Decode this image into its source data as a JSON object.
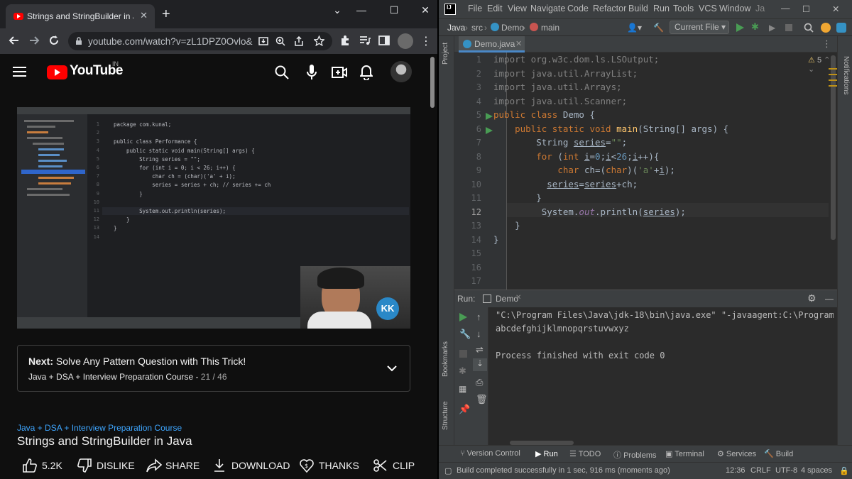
{
  "browser": {
    "tab_title": "Strings and StringBuilder in Ja",
    "url": "youtube.com/watch?v=zL1DPZ0Ovlo&l...",
    "new_tab": "+",
    "win_minimize": "—",
    "win_maximize": "☐",
    "win_close": "✕",
    "tab_close": "✕"
  },
  "youtube": {
    "logo_text": "YouTube",
    "region": "IN",
    "next_label": "Next:",
    "next_title": "Solve Any Pattern Question with This Trick!",
    "playlist": "Java + DSA + Interview Preparation Course -",
    "playlist_count": "21 / 46",
    "course_link": "Java + DSA + Interview Preparation Course",
    "video_title": "Strings and StringBuilder in Java",
    "actions": {
      "likes": "5.2K",
      "dislike": "DISLIKE",
      "share": "SHARE",
      "download": "DOWNLOAD",
      "thanks": "THANKS",
      "clip": "CLIP"
    },
    "embedded_video": {
      "lines": [
        "package com.kunal;",
        "",
        "public class Performance {",
        "    public static void main(String[] args) {",
        "        String series = \"\";",
        "        for (int i = 0; i < 26; i++) {",
        "            char ch = (char)('a' + i);",
        "            series = series + ch; // series += ch",
        "        }",
        "",
        "        System.out.println(series);",
        "    }",
        "}",
        ""
      ],
      "line_numbers": [
        "1",
        "2",
        "3",
        "4",
        "5",
        "6",
        "7",
        "8",
        "9",
        "10",
        "11",
        "12",
        "13",
        "14"
      ]
    }
  },
  "ide": {
    "menu": [
      "File",
      "Edit",
      "View",
      "Navigate",
      "Code",
      "Refactor",
      "Build",
      "Run",
      "Tools",
      "VCS",
      "Window",
      "Ja"
    ],
    "breadcrumb": [
      "Java",
      "src",
      "Demo",
      "main"
    ],
    "run_config": "Current File",
    "editor_tab": "Demo.java",
    "warnings": "5",
    "line_numbers": [
      "1",
      "2",
      "3",
      "4",
      "5",
      "6",
      "7",
      "8",
      "9",
      "10",
      "11",
      "12",
      "13",
      "14",
      "15",
      "16",
      "17"
    ],
    "code": {
      "l1": "import org.w3c.dom.ls.LSOutput;",
      "l2": "import java.util.ArrayList;",
      "l3": "import java.util.Arrays;",
      "l4": "import java.util.Scanner;"
    },
    "run_label": "Run:",
    "run_tab": "Demo",
    "console": [
      "\"C:\\Program Files\\Java\\jdk-18\\bin\\java.exe\" \"-javaagent:C:\\Program F:",
      "abcdefghijklmnopqrstuvwxyz",
      "",
      "Process finished with exit code 0"
    ],
    "left_tools": [
      "Project",
      "Bookmarks",
      "Structure"
    ],
    "right_tools": [
      "Notifications"
    ],
    "bottom_tabs": [
      "Version Control",
      "Run",
      "TODO",
      "Problems",
      "Terminal",
      "Services",
      "Build"
    ],
    "status": {
      "message": "Build completed successfully in 1 sec, 916 ms (moments ago)",
      "position": "12:36",
      "line_sep": "CRLF",
      "encoding": "UTF-8",
      "indent": "4 spaces"
    }
  }
}
